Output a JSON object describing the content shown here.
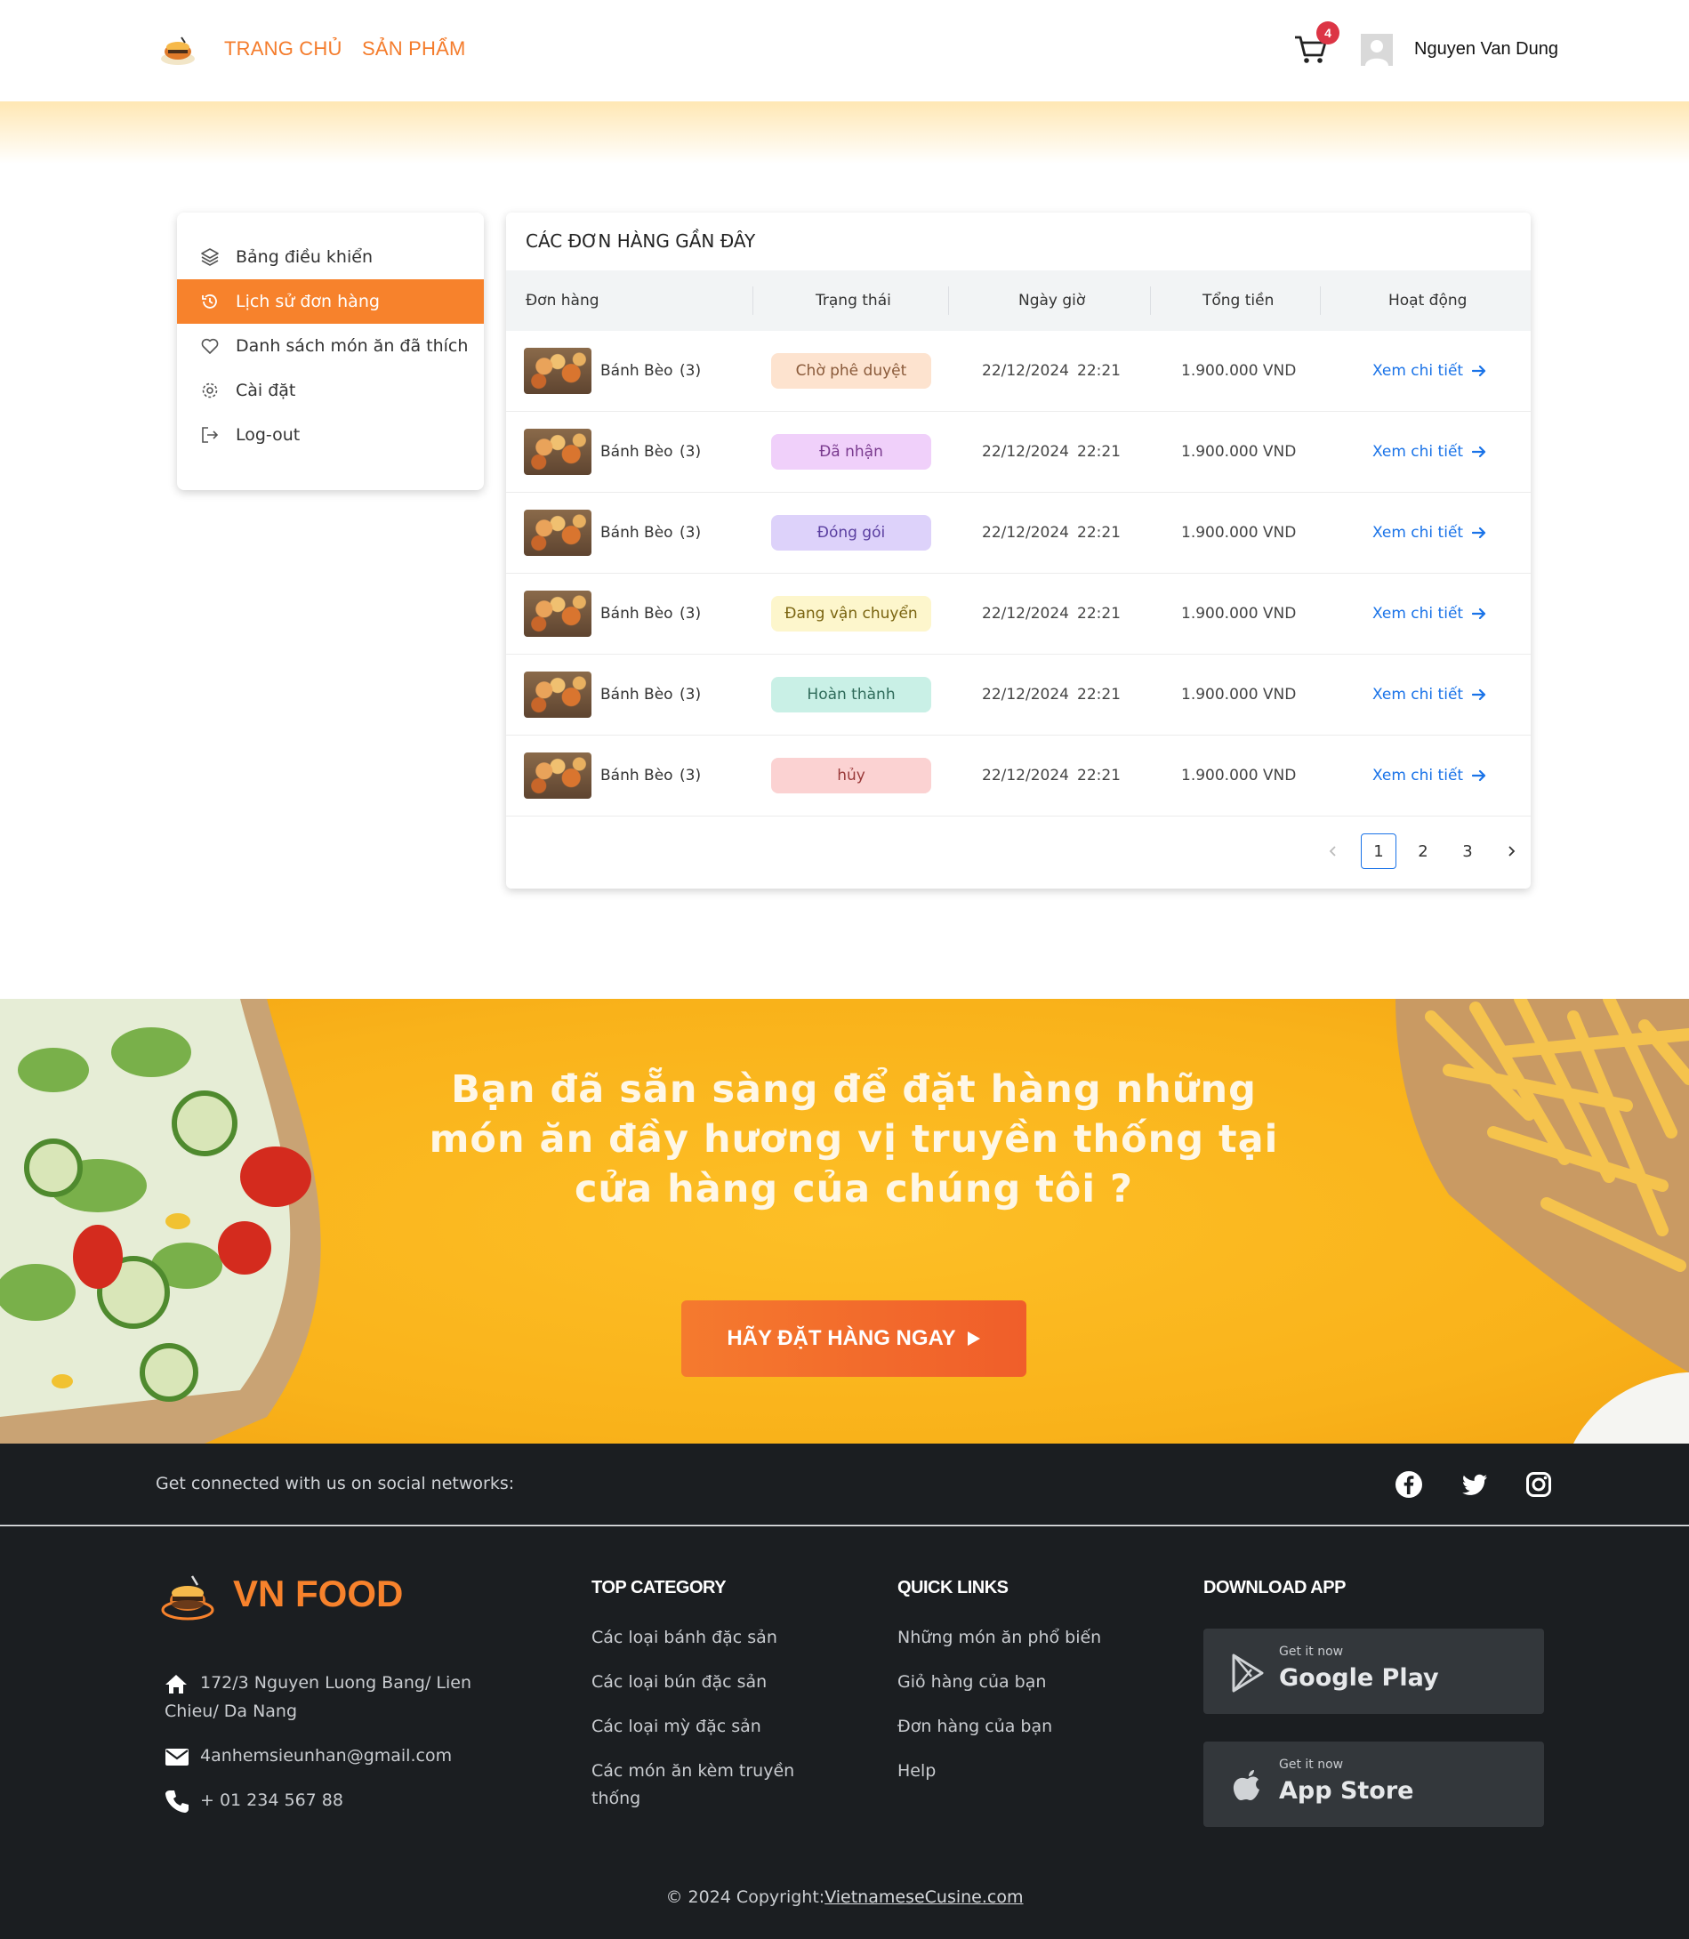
{
  "header": {
    "nav": [
      "TRANG CHỦ",
      "SẢN PHẨM"
    ],
    "cart_count": "4",
    "user_name": "Nguyen Van Dung"
  },
  "sidebar": {
    "items": [
      {
        "label": "Bảng điều khiển",
        "icon": "layers-icon",
        "active": false
      },
      {
        "label": "Lịch sử đơn hàng",
        "icon": "history-icon",
        "active": true
      },
      {
        "label": "Danh sách món ăn đã thích",
        "icon": "heart-icon",
        "active": false
      },
      {
        "label": "Cài đặt",
        "icon": "gear-icon",
        "active": false
      },
      {
        "label": "Log-out",
        "icon": "logout-icon",
        "active": false
      }
    ]
  },
  "orders": {
    "title": "CÁC ĐƠN HÀNG GẦN ĐÂY",
    "columns": [
      "Đơn hàng",
      "Trạng thái",
      "Ngày giờ",
      "Tổng tiền",
      "Hoạt động"
    ],
    "rows": [
      {
        "name": "Bánh Bèo",
        "qty": "(3)",
        "status": "Chờ phê duyệt",
        "date": "22/12/2024",
        "time": "22:21",
        "total": "1.900.000 VND",
        "action": "Xem chi tiết"
      },
      {
        "name": "Bánh Bèo",
        "qty": "(3)",
        "status": "Đã nhận",
        "date": "22/12/2024",
        "time": "22:21",
        "total": "1.900.000 VND",
        "action": "Xem chi tiết"
      },
      {
        "name": "Bánh Bèo",
        "qty": "(3)",
        "status": "Đóng gói",
        "date": "22/12/2024",
        "time": "22:21",
        "total": "1.900.000 VND",
        "action": "Xem chi tiết"
      },
      {
        "name": "Bánh Bèo",
        "qty": "(3)",
        "status": "Đang vận chuyển",
        "date": "22/12/2024",
        "time": "22:21",
        "total": "1.900.000 VND",
        "action": "Xem chi tiết"
      },
      {
        "name": "Bánh Bèo",
        "qty": "(3)",
        "status": "Hoàn thành",
        "date": "22/12/2024",
        "time": "22:21",
        "total": "1.900.000 VND",
        "action": "Xem chi tiết"
      },
      {
        "name": "Bánh Bèo",
        "qty": "(3)",
        "status": "hủy",
        "date": "22/12/2024",
        "time": "22:21",
        "total": "1.900.000 VND",
        "action": "Xem chi tiết"
      }
    ],
    "status_colors": {
      "Chờ phê duyệt": {
        "bg": "#fde3cf",
        "fg": "#8a5a3a"
      },
      "Đã nhận": {
        "bg": "#f0d0fa",
        "fg": "#7a3b8f"
      },
      "Đóng gói": {
        "bg": "#ddd2fa",
        "fg": "#5a3fa0"
      },
      "Đang vận chuyển": {
        "bg": "#fdf6cc",
        "fg": "#7a6410"
      },
      "Hoàn thành": {
        "bg": "#c9f0e6",
        "fg": "#2f6b5a"
      },
      "hủy": {
        "bg": "#fbd2d2",
        "fg": "#9a3a3a"
      }
    },
    "pagination": {
      "pages": [
        "1",
        "2",
        "3"
      ],
      "current": "1"
    }
  },
  "cta": {
    "text": "Bạn đã sẵn sàng để đặt hàng những món ăn đầy hương vị truyền thống tại cửa hàng của chúng tôi ?",
    "button": "HÃY ĐẶT HÀNG NGAY"
  },
  "social": {
    "text": "Get connected with us on social networks:",
    "icons": [
      "facebook-icon",
      "twitter-icon",
      "instagram-icon"
    ]
  },
  "footer": {
    "brand": "VN FOOD",
    "address": "172/3 Nguyen Luong Bang/ Lien Chieu/ Da Nang",
    "email": "4anhemsieunhan@gmail.com",
    "phone": "+ 01 234 567 88",
    "top_category": {
      "title": "TOP CATEGORY",
      "links": [
        "Các loại bánh đặc sản",
        "Các loại bún đặc sản",
        "Các loại mỳ đặc sản",
        "Các món ăn kèm truyền thống"
      ]
    },
    "quick_links": {
      "title": "QUICK LINKS",
      "links": [
        "Những món ăn phổ biến",
        "Giỏ hàng của bạn",
        "Đơn hàng của bạn",
        "Help"
      ]
    },
    "download": {
      "title": "DOWNLOAD APP",
      "google_small": "Get it now",
      "google_big": "Google Play",
      "apple_small": "Get it now",
      "apple_big": "App Store"
    },
    "copyright_prefix": "© 2024 Copyright:",
    "copyright_link": "VietnameseCusine.com"
  },
  "colors": {
    "accent": "#f7822c",
    "link": "#1a73e8",
    "banner": "#fbb81f",
    "footer_bg": "#1b1e21"
  }
}
